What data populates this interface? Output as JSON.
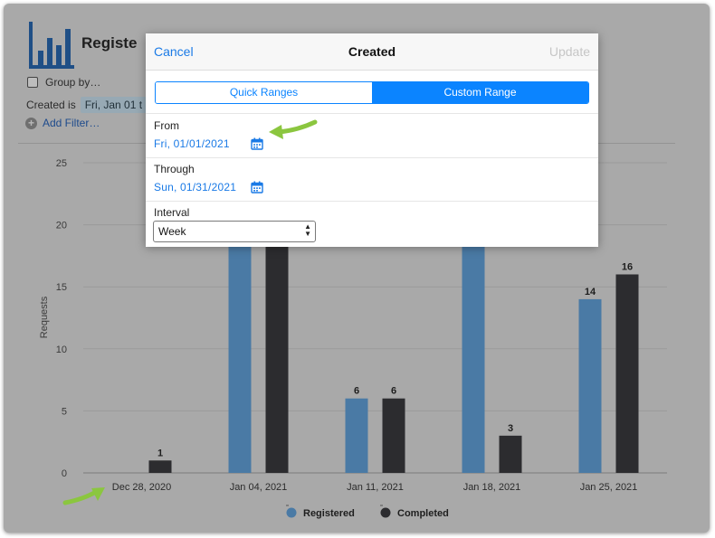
{
  "page": {
    "title_partial": "Registe",
    "group_by_label": "Group by…",
    "filter_field": "Created is",
    "filter_value": "Fri, Jan 01 t",
    "add_filter": "Add Filter…"
  },
  "modal": {
    "cancel": "Cancel",
    "title": "Created",
    "update": "Update",
    "tabs": [
      {
        "label": "Quick Ranges",
        "active": false
      },
      {
        "label": "Custom Range",
        "active": true
      }
    ],
    "from_label": "From",
    "from_value": "Fri, 01/01/2021",
    "through_label": "Through",
    "through_value": "Sun, 01/31/2021",
    "interval_label": "Interval",
    "interval_value": "Week"
  },
  "chart_data": {
    "type": "bar",
    "ylabel": "Requests",
    "xlabel": "",
    "ylim": [
      0,
      25
    ],
    "yticks": [
      0,
      5,
      10,
      15,
      20,
      25
    ],
    "categories": [
      "Dec 28, 2020",
      "Jan 04, 2021",
      "Jan 11, 2021",
      "Jan 18, 2021",
      "Jan 25, 2021"
    ],
    "series": [
      {
        "name": "Registered",
        "color": "#4a7aa5",
        "values": [
          0,
          21,
          6,
          21,
          14
        ],
        "labels": [
          null,
          null,
          "6",
          null,
          "14"
        ]
      },
      {
        "name": "Completed",
        "color": "#2c2c2f",
        "values": [
          1,
          21,
          6,
          3,
          16
        ],
        "labels": [
          "1",
          null,
          "6",
          "3",
          "16"
        ]
      }
    ],
    "legend_position": "bottom",
    "grid": true
  },
  "colors": {
    "accent": "#0b84ff",
    "overlay_bg": "#a9a9a9",
    "arrow": "#8bc63f"
  }
}
